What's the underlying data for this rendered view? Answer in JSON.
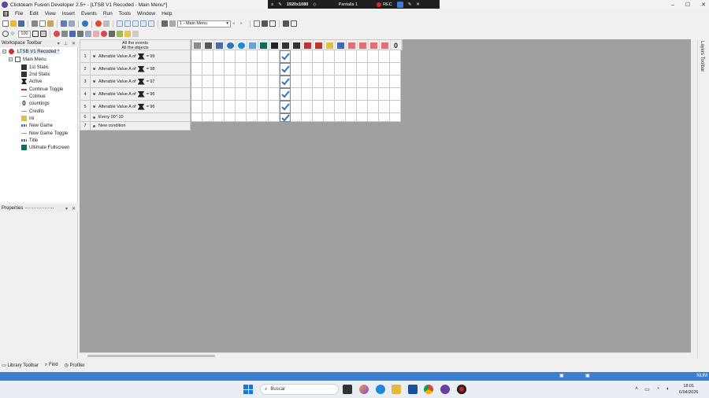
{
  "window": {
    "title": "Clickteam Fusion Developer 2.5+ - [LTSB V1 Recoded - Main Menu*]",
    "controls": [
      "–",
      "☐",
      "✕"
    ]
  },
  "recorder": {
    "resolution": "1920x1080",
    "screen": "Pantalla 1",
    "rec_label": "REC"
  },
  "menu": [
    "File",
    "Edit",
    "View",
    "Insert",
    "Events",
    "Run",
    "Tools",
    "Window",
    "Help"
  ],
  "toolbar": {
    "frame_select": "1 - Main Menu",
    "zoom": "100"
  },
  "workspace": {
    "header": "Workspace Toolbar",
    "items": [
      {
        "label": "LTSB V1 Recoded *",
        "icon": "app-icon"
      },
      {
        "label": "Main Menu",
        "icon": "frame-icon"
      },
      {
        "label": "1st Static",
        "icon": "static-icon"
      },
      {
        "label": "2nd Static",
        "icon": "static-icon"
      },
      {
        "label": "Active",
        "icon": "active-icon"
      },
      {
        "label": "Continue Toggle",
        "icon": "line-icon"
      },
      {
        "label": "Cotinue",
        "icon": "line-icon"
      },
      {
        "label": "countings",
        "icon": "counter-icon"
      },
      {
        "label": "Credits",
        "icon": "line-icon"
      },
      {
        "label": "Ini",
        "icon": "ini-icon"
      },
      {
        "label": "New Game",
        "icon": "text-icon"
      },
      {
        "label": "New Game Toggle",
        "icon": "line-icon"
      },
      {
        "label": "Title",
        "icon": "text-icon"
      },
      {
        "label": "Ultimate Fullscreen",
        "icon": "fullscreen-icon"
      }
    ]
  },
  "properties": {
    "header": "Properties"
  },
  "bottom_tabs": [
    "Library Toolbar",
    "Find",
    "Profiler"
  ],
  "event_editor": {
    "header_line1": "All the events",
    "header_line2": "All the objects",
    "events": [
      {
        "num": "1",
        "pre": "Alterable Value A of",
        "post": "= 99",
        "checked_col": 8
      },
      {
        "num": "2",
        "pre": "Alterable Value A of",
        "post": "= 98",
        "checked_col": 8
      },
      {
        "num": "3",
        "pre": "Alterable Value A of",
        "post": "= 97",
        "checked_col": 8
      },
      {
        "num": "4",
        "pre": "Alterable Value A of",
        "post": "= 96",
        "checked_col": 8
      },
      {
        "num": "5",
        "pre": "Alterable Value A of",
        "post": "= 96",
        "checked_col": 8
      },
      {
        "num": "6",
        "pre": "Every 00\"-10",
        "post": "",
        "checked_col": 8
      },
      {
        "num": "7",
        "pre": "New condition",
        "post": "",
        "checked_col": -1
      }
    ],
    "columns": 19,
    "last_column_label": "0"
  },
  "layers_label": "Layers Toolbar",
  "status": {
    "num": "NUM"
  },
  "taskbar": {
    "search_placeholder": "Buscar",
    "time": "18:01",
    "date": "6/04/2026"
  },
  "colors": {
    "status_bar": "#3c7fd1",
    "editor_bg": "#a0a0a0",
    "check": "#2f74c0"
  }
}
